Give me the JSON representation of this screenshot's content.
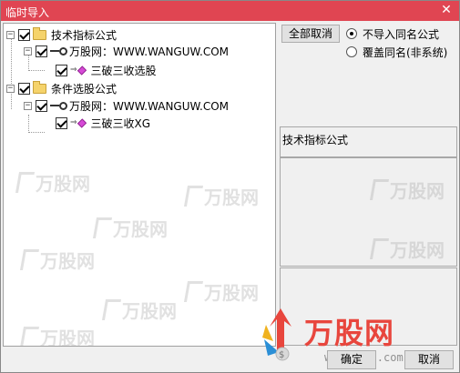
{
  "window": {
    "title": "临时导入",
    "close_glyph": "✕"
  },
  "tree": {
    "groups": [
      {
        "label": "技术指标公式",
        "expander": "−",
        "source": "万股网：WWW.WANGUW.COM",
        "source_expander": "−",
        "formula": "三破三收选股"
      },
      {
        "label": "条件选股公式",
        "expander": "−",
        "source": "万股网：WWW.WANGUW.COM",
        "source_expander": "−",
        "formula": "三破三收XG"
      }
    ]
  },
  "options": {
    "cancel_all_label": "全部取消",
    "radio_no_import": "不导入同名公式",
    "radio_overwrite": "覆盖同名(非系统)"
  },
  "info": {
    "label": "技术指标公式"
  },
  "logo": {
    "brand": "万股网",
    "site": "www.1082.com"
  },
  "watermark": {
    "text": "万股网"
  },
  "buttons": {
    "ok": "确定",
    "cancel": "取消"
  },
  "colors": {
    "titlebar": "#e04552",
    "brand_red": "#e8463d"
  }
}
